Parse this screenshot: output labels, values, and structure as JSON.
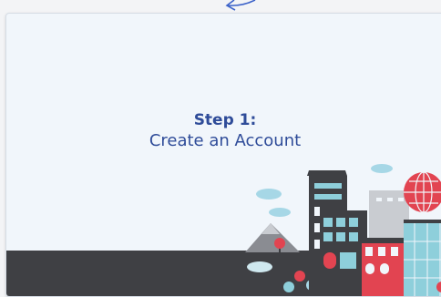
{
  "card": {
    "step_label": "Step 1:",
    "step_text": "Create an Account"
  },
  "colors": {
    "title": "#2f4c99",
    "background": "#f1f6fb",
    "ground": "#3f4044",
    "accent_red": "#e24451",
    "accent_teal": "#8ecfdb",
    "cloud": "#a6d7e6"
  },
  "icons": {
    "top_arrow": "back-arrow-icon"
  }
}
